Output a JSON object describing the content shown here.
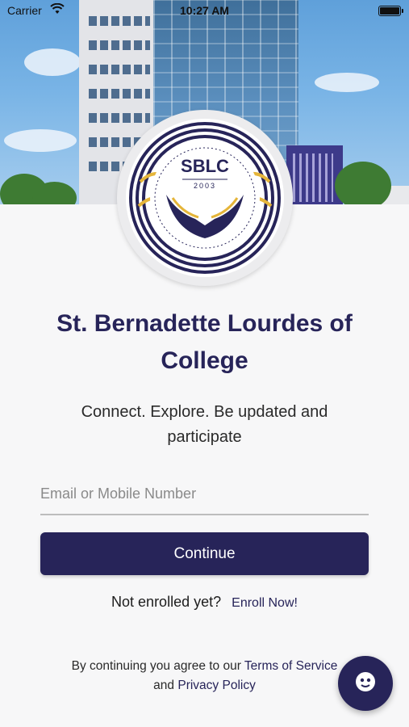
{
  "status_bar": {
    "carrier": "Carrier",
    "time": "10:27 AM"
  },
  "logo": {
    "text": "SBLC",
    "year": "2003",
    "colors": {
      "navy": "#272459",
      "gold": "#e5b53a"
    }
  },
  "college": {
    "name": "St. Bernadette Lourdes of College",
    "tagline": "Connect. Explore. Be updated and participate"
  },
  "login": {
    "input_placeholder": "Email or Mobile Number",
    "input_value": "",
    "continue_label": "Continue",
    "not_enrolled_text": "Not enrolled yet?",
    "enroll_link": "Enroll Now!"
  },
  "legal": {
    "prefix": "By continuing you agree to our",
    "terms_link": "Terms of Service",
    "and": "and",
    "privacy_link": "Privacy Policy"
  },
  "fab": {
    "icon": "chat-bot-icon"
  },
  "colors": {
    "primary": "#272459",
    "background": "#f7f7f8"
  }
}
